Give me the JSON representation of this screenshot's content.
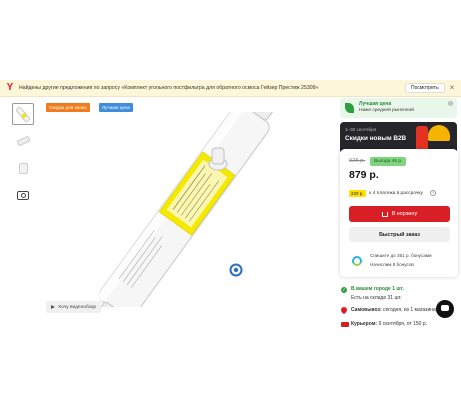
{
  "banner": {
    "text": "Найдены другие предложения по запросу «Комплект угольного постфильтра для обратного осмоса Гейзер Престиж 25309»",
    "button": "Посмотреть",
    "close": "×"
  },
  "tags": {
    "sale": "Скидка для своих",
    "best_price": "Лучшая цена"
  },
  "video": {
    "label": "Хочу видеообзор"
  },
  "best_price_box": {
    "title": "Лучшая цена",
    "subtitle": "Ниже средней рыночной"
  },
  "promo": {
    "date": "1–30 сентября",
    "title": "Скидки новым B2B"
  },
  "price_card": {
    "old_price": "925 р.",
    "savings": "Выгода 46 р.",
    "price": "879 р.",
    "split_badge": "220 р.",
    "split_text": "x 4 платежа в рассрочку",
    "cart_button": "В корзину",
    "quick_order": "Быстрый заказ",
    "bonus_line1": "Спишите до 351 р. бонусами",
    "bonus_line2": "Начислим 8 бонусов"
  },
  "availability": {
    "city_stock": "В вашем городе 1 шт.",
    "warehouse": "Есть на складе 31 шт.",
    "pickup_label": "Самовывоз:",
    "pickup_text": " сегодня, из 1 магазина",
    "courier_label": "Курьером:",
    "courier_text": " 9 сентября, от 150 р."
  },
  "colors": {
    "accent_red": "#d91f26",
    "green": "#2f9e3f",
    "filter_label": "#f2e600"
  }
}
